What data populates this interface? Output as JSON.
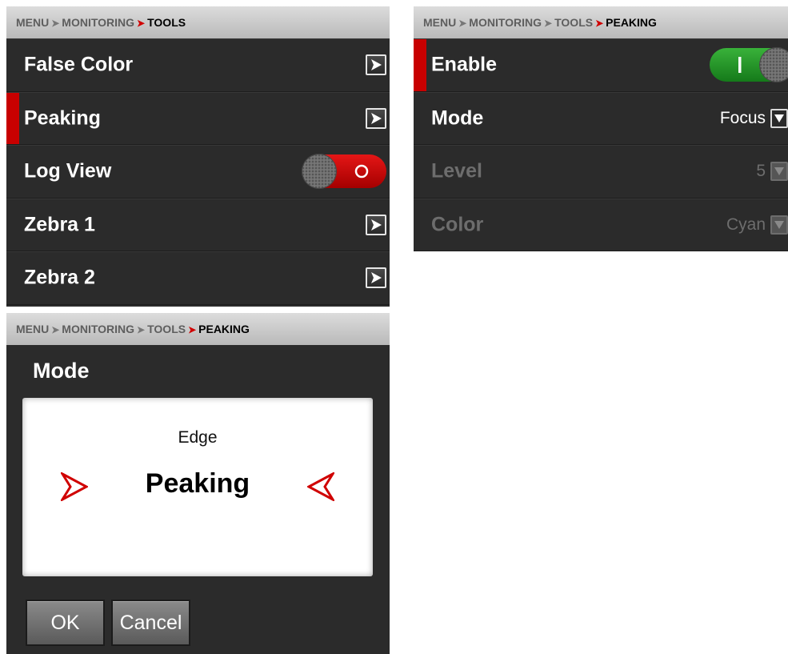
{
  "tools_panel": {
    "breadcrumb": [
      "MENU",
      "MONITORING",
      "TOOLS"
    ],
    "items": [
      {
        "label": "False Color",
        "control": "arrow"
      },
      {
        "label": "Peaking",
        "control": "arrow",
        "selected": true
      },
      {
        "label": "Log View",
        "control": "toggle",
        "state": "off"
      },
      {
        "label": "Zebra 1",
        "control": "arrow"
      },
      {
        "label": "Zebra 2",
        "control": "arrow"
      }
    ]
  },
  "peaking_panel": {
    "breadcrumb": [
      "MENU",
      "MONITORING",
      "TOOLS",
      "PEAKING"
    ],
    "items": [
      {
        "label": "Enable",
        "control": "toggle",
        "state": "on",
        "selected": true
      },
      {
        "label": "Mode",
        "value": "Focus",
        "control": "dropdown"
      },
      {
        "label": "Level",
        "value": "5",
        "control": "dropdown",
        "disabled": true
      },
      {
        "label": "Color",
        "value": "Cyan",
        "control": "dropdown",
        "disabled": true
      }
    ]
  },
  "mode_dialog": {
    "breadcrumb": [
      "MENU",
      "MONITORING",
      "TOOLS",
      "PEAKING"
    ],
    "title": "Mode",
    "option_previous": "Edge",
    "option_current": "Peaking",
    "ok_label": "OK",
    "cancel_label": "Cancel"
  },
  "colors": {
    "accent_red": "#c80000",
    "toggle_on": "#2a9a2c",
    "toggle_off": "#d10a0a",
    "panel_bg": "#2b2b2b"
  }
}
